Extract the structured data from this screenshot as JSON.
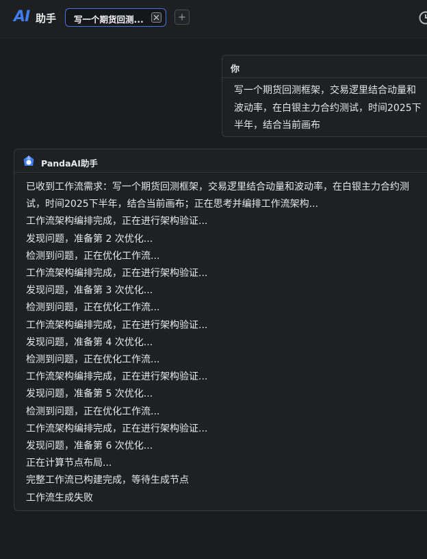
{
  "header": {
    "logo": "AI",
    "title": "助手",
    "tab_label": "写一个期货回测...",
    "icons": {
      "close": "close-icon",
      "add": "plus-icon",
      "history": "clock-icon"
    }
  },
  "chat": {
    "user": {
      "name": "你",
      "text": "写一个期货回测框架，交易逻里结合动量和波动率，在白银主力合约测试，时间2025下半年，结合当前画布"
    },
    "assistant": {
      "name": "PandaAI助手",
      "avatar_icon": "panda-logo-icon",
      "brand_color": "#3e7df0",
      "lines": [
        "已收到工作流需求：写一个期货回测框架，交易逻里结合动量和波动率，在白银主力合约测试，时间2025下半年，结合当前画布；正在思考并编排工作流架构...",
        "工作流架构编排完成，正在进行架构验证...",
        "发现问题，准备第 2 次优化...",
        "检测到问题，正在优化工作流...",
        "工作流架构编排完成，正在进行架构验证...",
        "发现问题，准备第 3 次优化...",
        "检测到问题，正在优化工作流...",
        "工作流架构编排完成，正在进行架构验证...",
        "发现问题，准备第 4 次优化...",
        "检测到问题，正在优化工作流...",
        "工作流架构编排完成，正在进行架构验证...",
        "发现问题，准备第 5 次优化...",
        "检测到问题，正在优化工作流...",
        "工作流架构编排完成，正在进行架构验证...",
        "发现问题，准备第 6 次优化...",
        "正在计算节点布局...",
        "完整工作流已构建完成，等待生成节点",
        "工作流生成失败"
      ]
    }
  }
}
